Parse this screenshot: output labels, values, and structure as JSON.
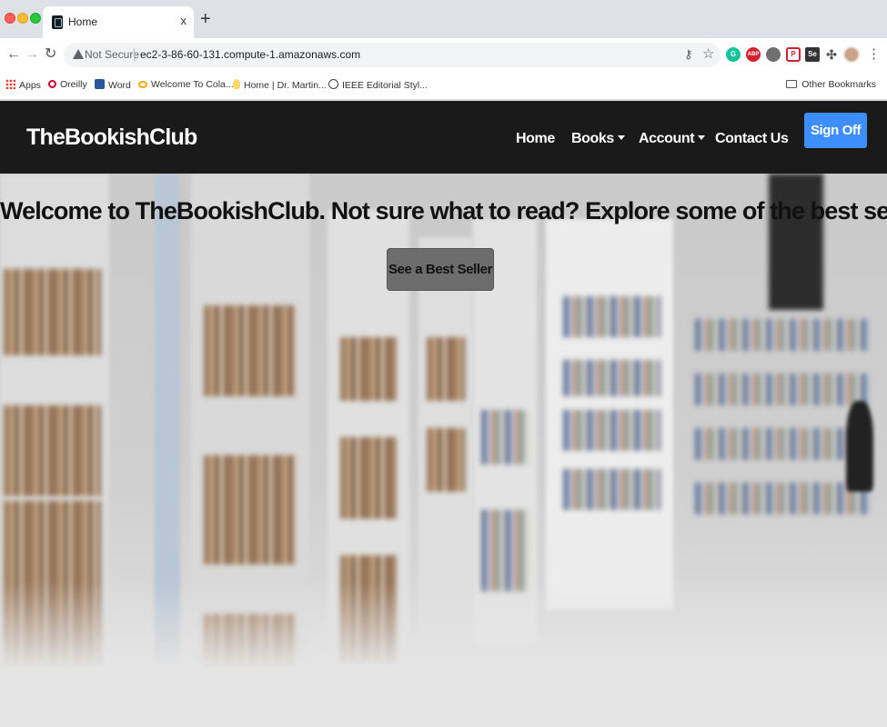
{
  "browser": {
    "tab_title": "Home",
    "tab_close": "x",
    "new_tab": "+",
    "security_label": "Not Secure",
    "url": "ec2-3-86-60-131.compute-1.amazonaws.com",
    "bookmarks": [
      {
        "label": "Apps",
        "icon": "apps-grid-icon"
      },
      {
        "label": "Oreilly",
        "icon": "oreilly-icon"
      },
      {
        "label": "Word",
        "icon": "word-icon"
      },
      {
        "label": "Welcome To Cola...",
        "icon": "colab-icon"
      },
      {
        "label": "Home | Dr. Martin...",
        "icon": "lightbulb-icon"
      },
      {
        "label": "IEEE Editorial Styl...",
        "icon": "globe-icon"
      }
    ],
    "other_bookmarks": "Other Bookmarks",
    "extensions": {
      "grammarly": "G",
      "adblock": "ABP",
      "pocket": "P",
      "selenium": "Se"
    },
    "colors": {
      "tab_bg": "#dee1e6",
      "toolbar_bg": "#ffffff"
    }
  },
  "site": {
    "brand": "TheBookishClub",
    "nav": {
      "home": "Home",
      "books": "Books",
      "account": "Account",
      "contact": "Contact Us",
      "sign_off": "Sign Off"
    },
    "hero": {
      "headline": "Welcome to TheBookishClub. Not sure what to read? Explore some of the best sellers.",
      "cta": "See a Best Seller"
    },
    "colors": {
      "navbar": "#1b1a1a",
      "sign_off": "#3d8eff",
      "cta": "#6d6d6d"
    }
  }
}
